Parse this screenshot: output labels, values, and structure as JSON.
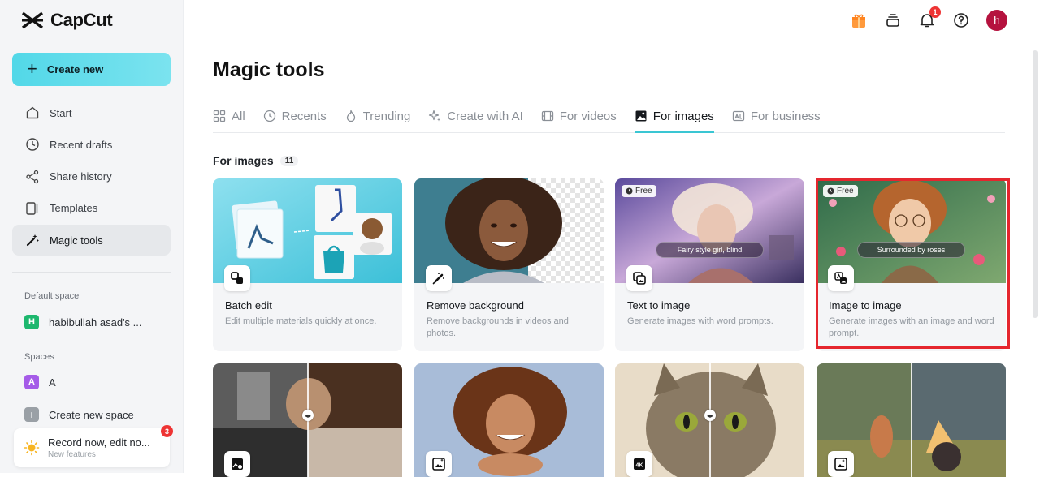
{
  "app": {
    "name": "CapCut"
  },
  "sidebar": {
    "create_label": "Create new",
    "items": [
      {
        "label": "Start",
        "icon": "home-icon"
      },
      {
        "label": "Recent drafts",
        "icon": "clock-icon"
      },
      {
        "label": "Share history",
        "icon": "share-icon"
      },
      {
        "label": "Templates",
        "icon": "templates-icon"
      },
      {
        "label": "Magic tools",
        "icon": "magic-wand-icon",
        "active": true
      }
    ],
    "default_space_label": "Default space",
    "default_space_initial": "H",
    "default_space_name": "habibullah asad's ...",
    "spaces_label": "Spaces",
    "space_a_initial": "A",
    "space_a_name": "A",
    "create_space_label": "Create new space",
    "record_title": "Record now, edit no...",
    "record_sub": "New features",
    "record_badge": "3"
  },
  "topbar": {
    "notification_count": "1",
    "avatar_initial": "h"
  },
  "main": {
    "title": "Magic tools",
    "tabs": [
      {
        "label": "All"
      },
      {
        "label": "Recents"
      },
      {
        "label": "Trending"
      },
      {
        "label": "Create with AI"
      },
      {
        "label": "For videos"
      },
      {
        "label": "For images",
        "active": true
      },
      {
        "label": "For business"
      }
    ],
    "section_title": "For images",
    "section_count": "11",
    "cards": [
      {
        "name": "Batch edit",
        "desc": "Edit multiple materials quickly at once."
      },
      {
        "name": "Remove background",
        "desc": "Remove backgrounds in videos and photos."
      },
      {
        "name": "Text to image",
        "desc": "Generate images with word prompts.",
        "chip": "Free",
        "prompt": "Fairy style girl, blind"
      },
      {
        "name": "Image to image",
        "desc": "Generate images with an image and word prompt.",
        "chip": "Free",
        "prompt": "Surrounded by roses"
      }
    ]
  },
  "colors": {
    "accent": "#3ac6d3",
    "brand_button": "#52d8e8",
    "highlight": "#e5262e",
    "badge": "#ee3434"
  }
}
